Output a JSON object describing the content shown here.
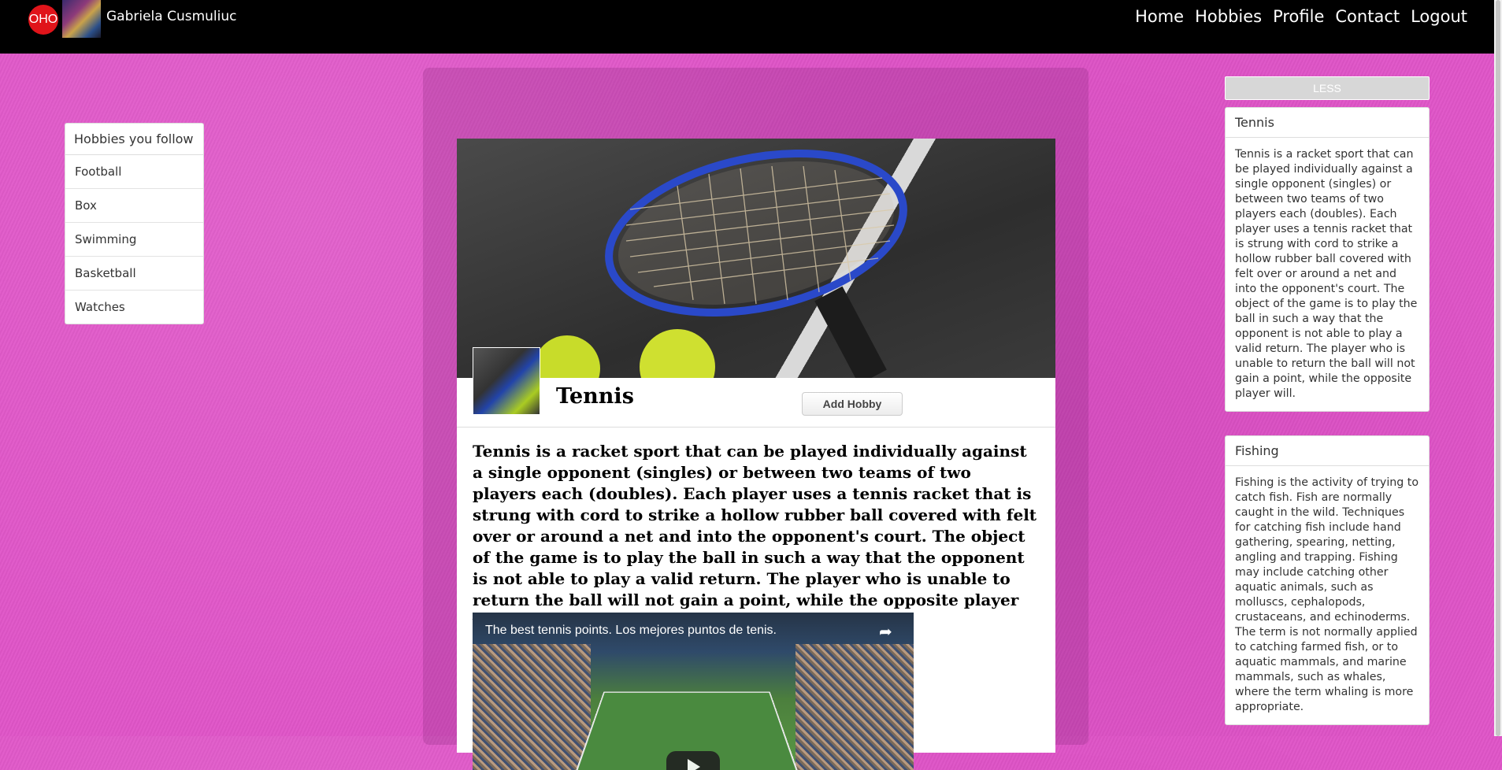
{
  "colors": {
    "background": "#e055c8",
    "navbar": "#000000",
    "logo_badge": "#e0141a"
  },
  "navbar": {
    "logo_text": "OHO",
    "user_name": "Gabriela Cusmuliuc",
    "links": [
      "Home",
      "Hobbies",
      "Profile",
      "Contact",
      "Logout"
    ]
  },
  "follow_panel": {
    "header": "Hobbies you follow",
    "items": [
      "Football",
      "Box",
      "Swimming",
      "Basketball",
      "Watches"
    ]
  },
  "hobby": {
    "title": "Tennis",
    "add_button": "Add Hobby",
    "description": "Tennis is a racket sport that can be played individually against a single opponent (singles) or between two teams of two players each (doubles). Each player uses a tennis racket that is strung with cord to strike a hollow rubber ball covered with felt over or around a net and into the opponent's court. The object of the game is to play the ball in such a way that the opponent is not able to play a valid return. The player who is unable to return the ball will not gain a point, while the opposite player will.",
    "video_title": "The best tennis points. Los mejores puntos de tenis."
  },
  "sidebar": {
    "less_button": "LESS",
    "cards": [
      {
        "title": "Tennis",
        "text": "Tennis is a racket sport that can be played individually against a single opponent (singles) or between two teams of two players each (doubles). Each player uses a tennis racket that is strung with cord to strike a hollow rubber ball covered with felt over or around a net and into the opponent's court. The object of the game is to play the ball in such a way that the opponent is not able to play a valid return. The player who is unable to return the ball will not gain a point, while the opposite player will."
      },
      {
        "title": "Fishing",
        "text": "Fishing is the activity of trying to catch fish. Fish are normally caught in the wild. Techniques for catching fish include hand gathering, spearing, netting, angling and trapping. Fishing may include catching other aquatic animals, such as molluscs, cephalopods, crustaceans, and echinoderms. The term is not normally applied to catching farmed fish, or to aquatic mammals, and marine mammals, such as whales, where the term whaling is more appropriate."
      }
    ]
  }
}
